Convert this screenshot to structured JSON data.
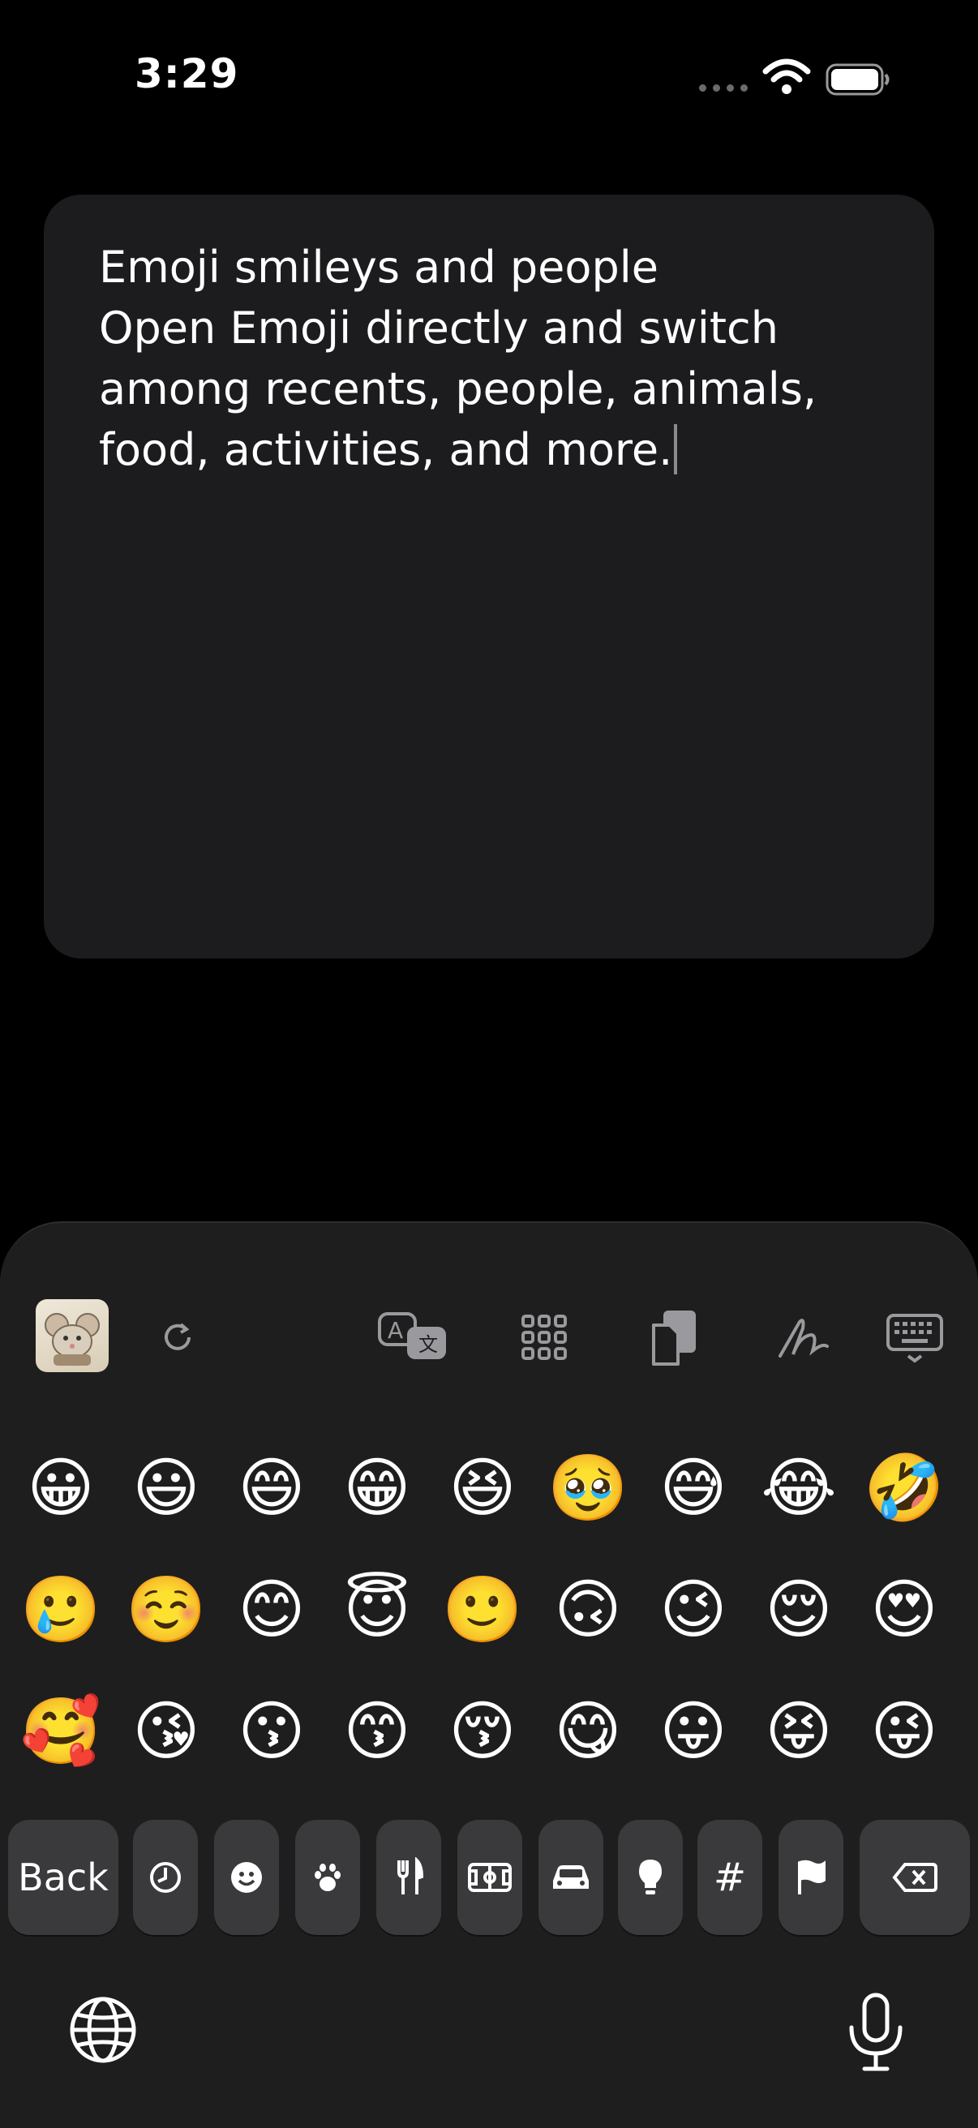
{
  "status_bar": {
    "time": "3:29"
  },
  "note": {
    "text": "Emoji smileys and people\nOpen Emoji directly and switch among recents, people, animals, food, activities, and more."
  },
  "note_lines": [
    "Emoji smileys and people",
    "Open Emoji directly and switch",
    "among recents, people, animals,",
    "food, activities, and more."
  ],
  "emoji_rows": [
    [
      "😀",
      "😃",
      "😄",
      "😁",
      "😆",
      "🥹",
      "😅",
      "😂",
      "🤣"
    ],
    [
      "🥲",
      "☺️",
      "😊",
      "😇",
      "🙂",
      "🙃",
      "😉",
      "😌",
      "😍"
    ],
    [
      "🥰",
      "😘",
      "😗",
      "😙",
      "😚",
      "😋",
      "😛",
      "😝",
      "😜"
    ]
  ],
  "category_bar": {
    "back_label": "Back",
    "hash_label": "#",
    "categories": [
      "recents-icon",
      "smileys-icon",
      "animals-icon",
      "food-icon",
      "activities-icon",
      "travel-icon",
      "objects-icon",
      "symbols-icon",
      "flags-icon"
    ]
  },
  "toolbar_icons": [
    "sticker-thumbnail",
    "refresh-icon",
    "translate-icon",
    "grid-icon",
    "clipboard-icon",
    "handwriting-icon",
    "keyboard-dismiss-icon"
  ],
  "colors": {
    "background": "#000000",
    "card": "#1c1c1e",
    "keyboard": "#1e1e1e",
    "key": "#3a3a3c"
  }
}
